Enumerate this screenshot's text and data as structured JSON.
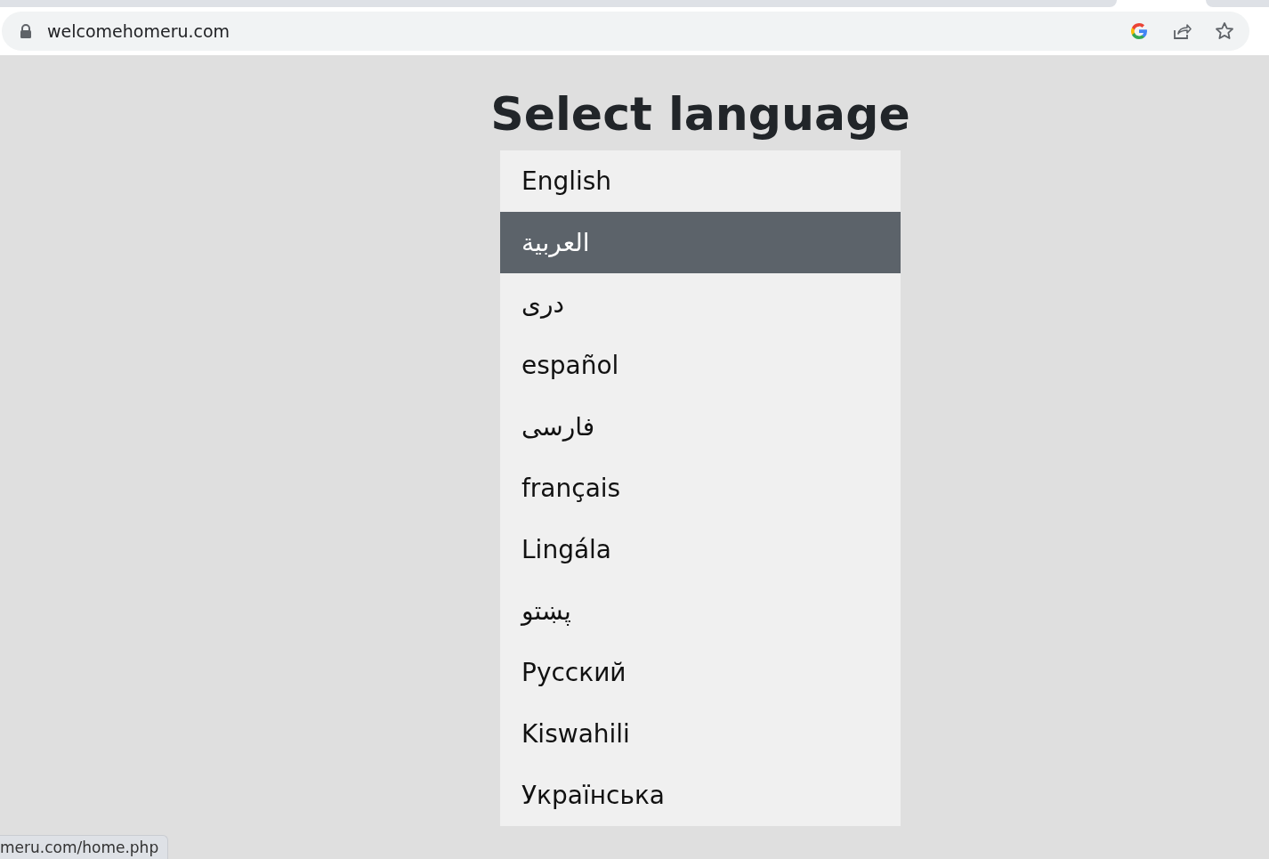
{
  "browser": {
    "url": "welcomehomeru.com"
  },
  "title": "Select language",
  "languages": [
    {
      "label": "English",
      "selected": false
    },
    {
      "label": "العربية",
      "selected": true
    },
    {
      "label": "دری",
      "selected": false
    },
    {
      "label": "español",
      "selected": false
    },
    {
      "label": "فارسی",
      "selected": false
    },
    {
      "label": "français",
      "selected": false
    },
    {
      "label": "Lingála",
      "selected": false
    },
    {
      "label": "پښتو",
      "selected": false
    },
    {
      "label": "Русский",
      "selected": false
    },
    {
      "label": "Kiswahili",
      "selected": false
    },
    {
      "label": "Українська",
      "selected": false
    }
  ],
  "status_bar": {
    "link": "meru.com/home.php"
  }
}
